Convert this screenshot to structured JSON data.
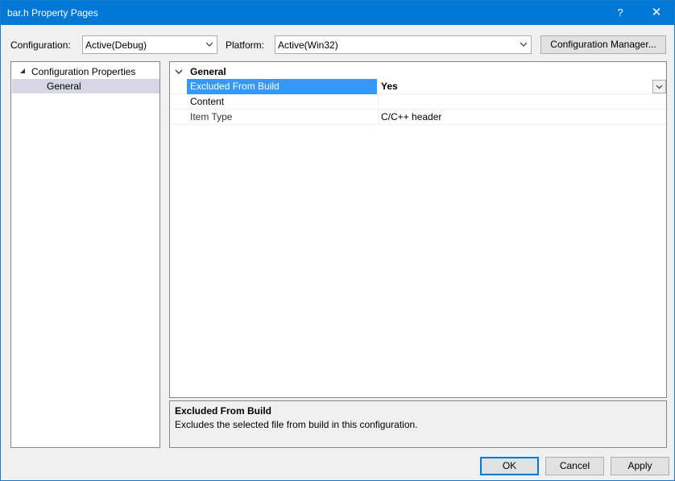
{
  "window": {
    "title": "bar.h Property Pages",
    "help_glyph": "?",
    "close_glyph": "✕"
  },
  "toolbar": {
    "configuration_label": "Configuration:",
    "configuration_value": "Active(Debug)",
    "platform_label": "Platform:",
    "platform_value": "Active(Win32)",
    "config_manager_label": "Configuration Manager..."
  },
  "tree": {
    "root_label": "Configuration Properties",
    "child_label": "General"
  },
  "grid": {
    "category": "General",
    "rows": [
      {
        "name": "Excluded From Build",
        "value": "Yes"
      },
      {
        "name": "Content",
        "value": ""
      },
      {
        "name": "Item Type",
        "value": "C/C++ header"
      }
    ]
  },
  "description": {
    "title": "Excluded From Build",
    "text": "Excludes the selected file from build in this configuration."
  },
  "buttons": {
    "ok": "OK",
    "cancel": "Cancel",
    "apply": "Apply"
  },
  "colors": {
    "titlebar": "#0078d7",
    "selection": "#3399ff",
    "tree_selection": "#d6d6e6"
  }
}
